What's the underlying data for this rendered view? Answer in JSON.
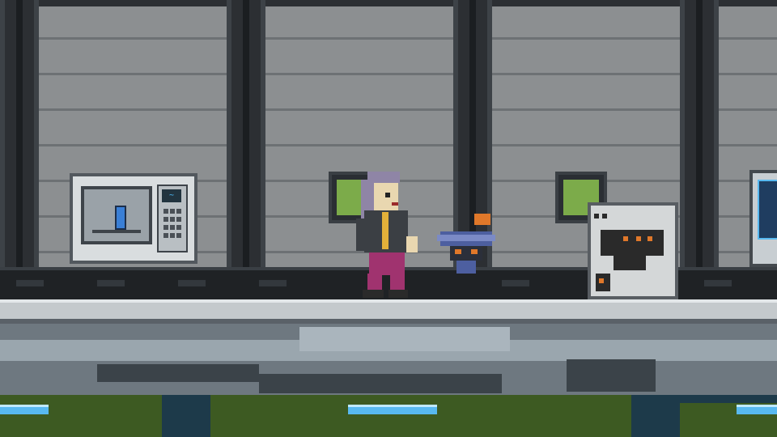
{
  "scene": {
    "type": "2d-pixel-platformer",
    "setting": "spaceship-interior",
    "hud_visible": false
  },
  "objects": {
    "terminal": {
      "icon": "computer-terminal-icon",
      "display_text": "~",
      "bottle_color": "#3a7fd6"
    },
    "character": {
      "icon": "player-character",
      "hair_color": "#8f85a6",
      "pants_color": "#a0336f",
      "jacket_color": "#3b3f44"
    },
    "pet": {
      "icon": "robot-pet-icon",
      "body_color": "#4d5fa0",
      "accent_color": "#e0782a"
    },
    "crate": {
      "icon": "storage-locker-icon",
      "emblem_color": "#2a2a2a",
      "accent_color": "#e0782a"
    },
    "window_view_color": "#7cab4a",
    "thruster_color": "#58b9f0"
  }
}
